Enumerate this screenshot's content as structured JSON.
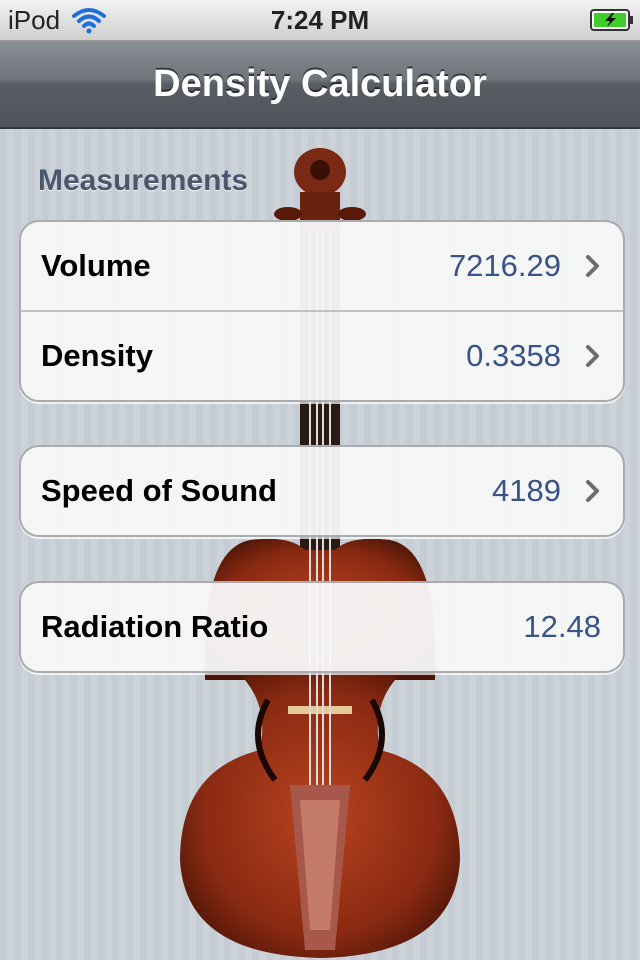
{
  "status_bar": {
    "carrier": "iPod",
    "time": "7:24 PM",
    "icons": [
      "wifi-icon",
      "battery-charging-icon"
    ]
  },
  "nav_bar": {
    "title": "Density Calculator"
  },
  "measurements": {
    "header": "Measurements",
    "rows": [
      {
        "label": "Volume",
        "value": "7216.29",
        "icon": "chevron-right-icon"
      },
      {
        "label": "Density",
        "value": "0.3358",
        "icon": "chevron-right-icon"
      }
    ]
  },
  "speed": {
    "rows": [
      {
        "label": "Speed of Sound",
        "value": "4189",
        "icon": "chevron-right-icon"
      }
    ]
  },
  "radiation": {
    "rows": [
      {
        "label": "Radiation Ratio",
        "value": "12.48"
      }
    ]
  },
  "colors": {
    "value_text": "#385487",
    "section_header": "#4c566c",
    "nav_bar": "#6e747a"
  }
}
